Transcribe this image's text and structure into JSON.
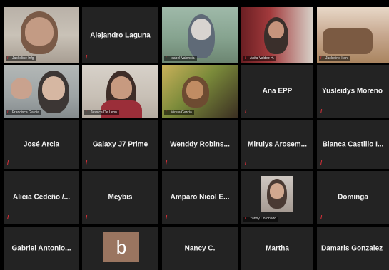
{
  "participants": [
    {
      "id": "p1",
      "display": "video",
      "tag": "Jackeline Infg",
      "muted": true
    },
    {
      "id": "p2",
      "display": "name",
      "name": "Alejandro Laguna",
      "muted": true
    },
    {
      "id": "p3",
      "display": "video",
      "tag": "Isabel Valencia",
      "muted": true
    },
    {
      "id": "p4",
      "display": "video",
      "tag": "Anita Valdez H.",
      "muted": true
    },
    {
      "id": "p5",
      "display": "video",
      "tag": "Jackeline Iran",
      "muted": true
    },
    {
      "id": "p6",
      "display": "video",
      "tag": "Francisca Garcia",
      "muted": false
    },
    {
      "id": "p7",
      "display": "video",
      "tag": "Jessica De Leon",
      "muted": false,
      "active": true
    },
    {
      "id": "p8",
      "display": "video",
      "tag": "Mireia Garcia",
      "muted": true
    },
    {
      "id": "p9",
      "display": "name",
      "name": "Ana EPP",
      "muted": true
    },
    {
      "id": "p10",
      "display": "name",
      "name": "Yusleidys Moreno",
      "muted": true
    },
    {
      "id": "p11",
      "display": "name",
      "name": "José Arcia",
      "muted": true
    },
    {
      "id": "p12",
      "display": "name",
      "name": "Galaxy J7 Prime",
      "muted": true
    },
    {
      "id": "p13",
      "display": "name",
      "name": "Wenddy Robins...",
      "muted": true
    },
    {
      "id": "p14",
      "display": "name",
      "name": "Miruiys Arosem...",
      "muted": true
    },
    {
      "id": "p15",
      "display": "name",
      "name": "Blanca Castillo I...",
      "muted": true
    },
    {
      "id": "p16",
      "display": "name",
      "name": "Alicia Cedeño /...",
      "muted": true
    },
    {
      "id": "p17",
      "display": "name",
      "name": "Meybis",
      "muted": true
    },
    {
      "id": "p18",
      "display": "name",
      "name": "Amparo Nicol E...",
      "muted": true
    },
    {
      "id": "p19",
      "display": "video",
      "tag": "Yanny Coronado",
      "muted": true
    },
    {
      "id": "p20",
      "display": "name",
      "name": "Dominga",
      "muted": true
    },
    {
      "id": "p21",
      "display": "name",
      "name": "Gabriel Antonio...",
      "muted": false
    },
    {
      "id": "p22",
      "display": "avatar",
      "avatar_letter": "b",
      "muted": false
    },
    {
      "id": "p23",
      "display": "name",
      "name": "Nancy C.",
      "muted": false
    },
    {
      "id": "p24",
      "display": "name",
      "name": "Martha",
      "muted": false
    },
    {
      "id": "p25",
      "display": "name",
      "name": "Damaris Gonzalez",
      "muted": false
    }
  ],
  "icons": {
    "muted_mic": "muted-mic-icon"
  },
  "colors": {
    "background": "#000000",
    "tile": "#232323",
    "active_speaker_border": "#c7d83a",
    "muted_red": "#e0303a"
  }
}
